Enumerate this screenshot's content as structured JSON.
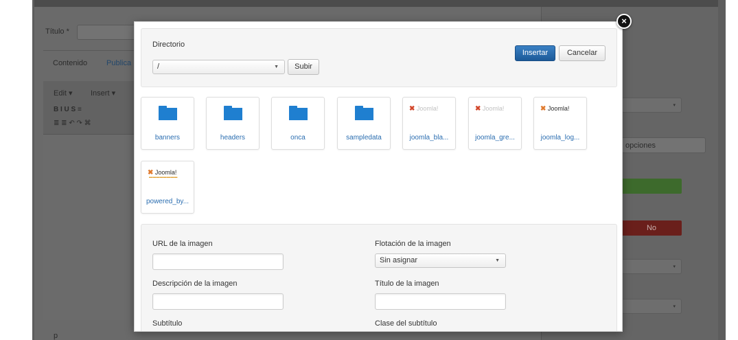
{
  "background": {
    "title_label": "Título *",
    "tabs": [
      "Contenido",
      "Publica"
    ],
    "editor_menu": [
      "Edit ▾",
      "Insert ▾"
    ],
    "toolbar_row1": "B  I  U  S  ≡ ",
    "toolbar_row2": "≣  ≣   ↶  ↷  ⌘",
    "options_text": "opciones",
    "no_button": "No",
    "footer_char": "p"
  },
  "modal": {
    "close_glyph": "×",
    "directory_label": "Directorio",
    "directory_value": "/",
    "up_button": "Subir",
    "insert_button": "Insertar",
    "cancel_button": "Cancelar",
    "files": [
      {
        "name": "banners",
        "kind": "folder"
      },
      {
        "name": "headers",
        "kind": "folder"
      },
      {
        "name": "onca",
        "kind": "folder"
      },
      {
        "name": "sampledata",
        "kind": "folder"
      },
      {
        "name": "joomla_bla...",
        "kind": "image",
        "thumb": "Joomla!"
      },
      {
        "name": "joomla_gre...",
        "kind": "image",
        "thumb": "Joomla!"
      },
      {
        "name": "joomla_log...",
        "kind": "image",
        "thumb": "Joomla!"
      },
      {
        "name": "powered_by...",
        "kind": "image",
        "thumb": "Joomla!"
      }
    ],
    "form": {
      "url_label": "URL de la imagen",
      "url_value": "",
      "float_label": "Flotación de la imagen",
      "float_value": "Sin asignar",
      "desc_label": "Descripción de la imagen",
      "desc_value": "",
      "title_label": "Título de la imagen",
      "title_value": "",
      "caption_label": "Subtítulo",
      "caption_class_label": "Clase del subtítulo"
    }
  },
  "colors": {
    "primary_button": "#1c5a98",
    "folder": "#1f7fd0",
    "link": "#2a6db0"
  }
}
